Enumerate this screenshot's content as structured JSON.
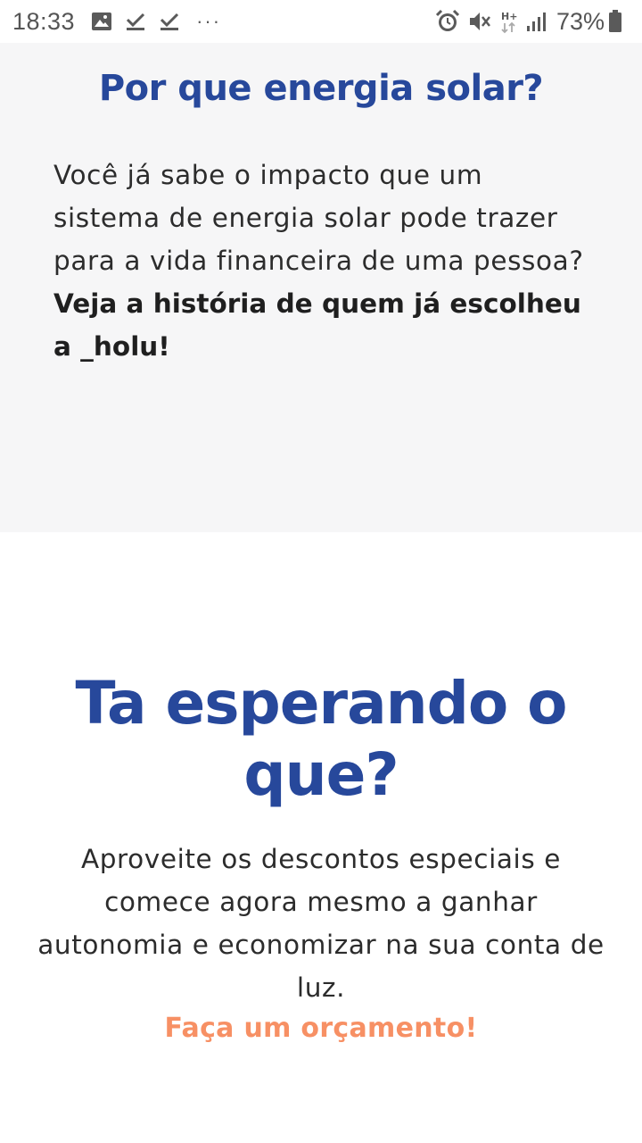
{
  "status_bar": {
    "time": "18:33",
    "left_icons": [
      "image-icon",
      "download-done-icon",
      "download-done-icon",
      "more-dots-icon"
    ],
    "more": "···",
    "right_icons": [
      "alarm-icon",
      "vibrate-mute-icon",
      "hplus-data-icon",
      "signal-icon",
      "battery-icon"
    ],
    "network_label": "H+",
    "battery": "73%"
  },
  "why_section": {
    "title": "Por que energia solar?",
    "text_regular": "Você já sabe o impacto que um sistema de energia solar pode trazer para a vida financeira de uma pessoa? ",
    "text_bold": "Veja a história de quem já escolheu a _holu!"
  },
  "cta_section": {
    "title": "Ta esperando o que?",
    "text": "Aproveite os descontos especiais e comece agora mesmo a ganhar autonomia e economizar na sua conta de luz.",
    "link": "Faça um orçamento!"
  },
  "colors": {
    "title_blue": "#27489b",
    "link_orange": "#f79064",
    "section_bg": "#f6f6f7"
  }
}
